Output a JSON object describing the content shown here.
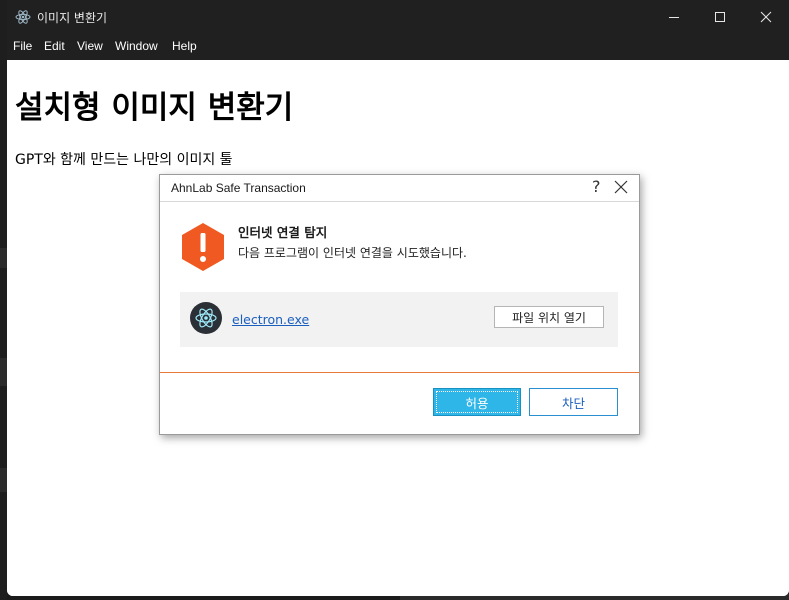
{
  "window": {
    "title": "이미지 변환기",
    "controls": {
      "minimize": "minimize-icon",
      "maximize": "maximize-icon",
      "close": "close-icon"
    }
  },
  "menu": [
    "File",
    "Edit",
    "View",
    "Window",
    "Help"
  ],
  "page": {
    "heading": "설치형 이미지 변환기",
    "subtitle": "GPT와 함께 만드는 나만의 이미지 툴"
  },
  "dialog": {
    "title": "AhnLab Safe Transaction",
    "help": "?",
    "alert_title": "인터넷 연결 탐지",
    "alert_desc": "다음 프로그램이 인터넷 연결을 시도했습니다.",
    "program_name": "electron.exe",
    "open_location_label": "파일 위치 열기",
    "allow_label": "허용",
    "block_label": "차단",
    "colors": {
      "accent": "#2fb6e8",
      "warning": "#f05a22",
      "separator": "#e8793a"
    }
  }
}
